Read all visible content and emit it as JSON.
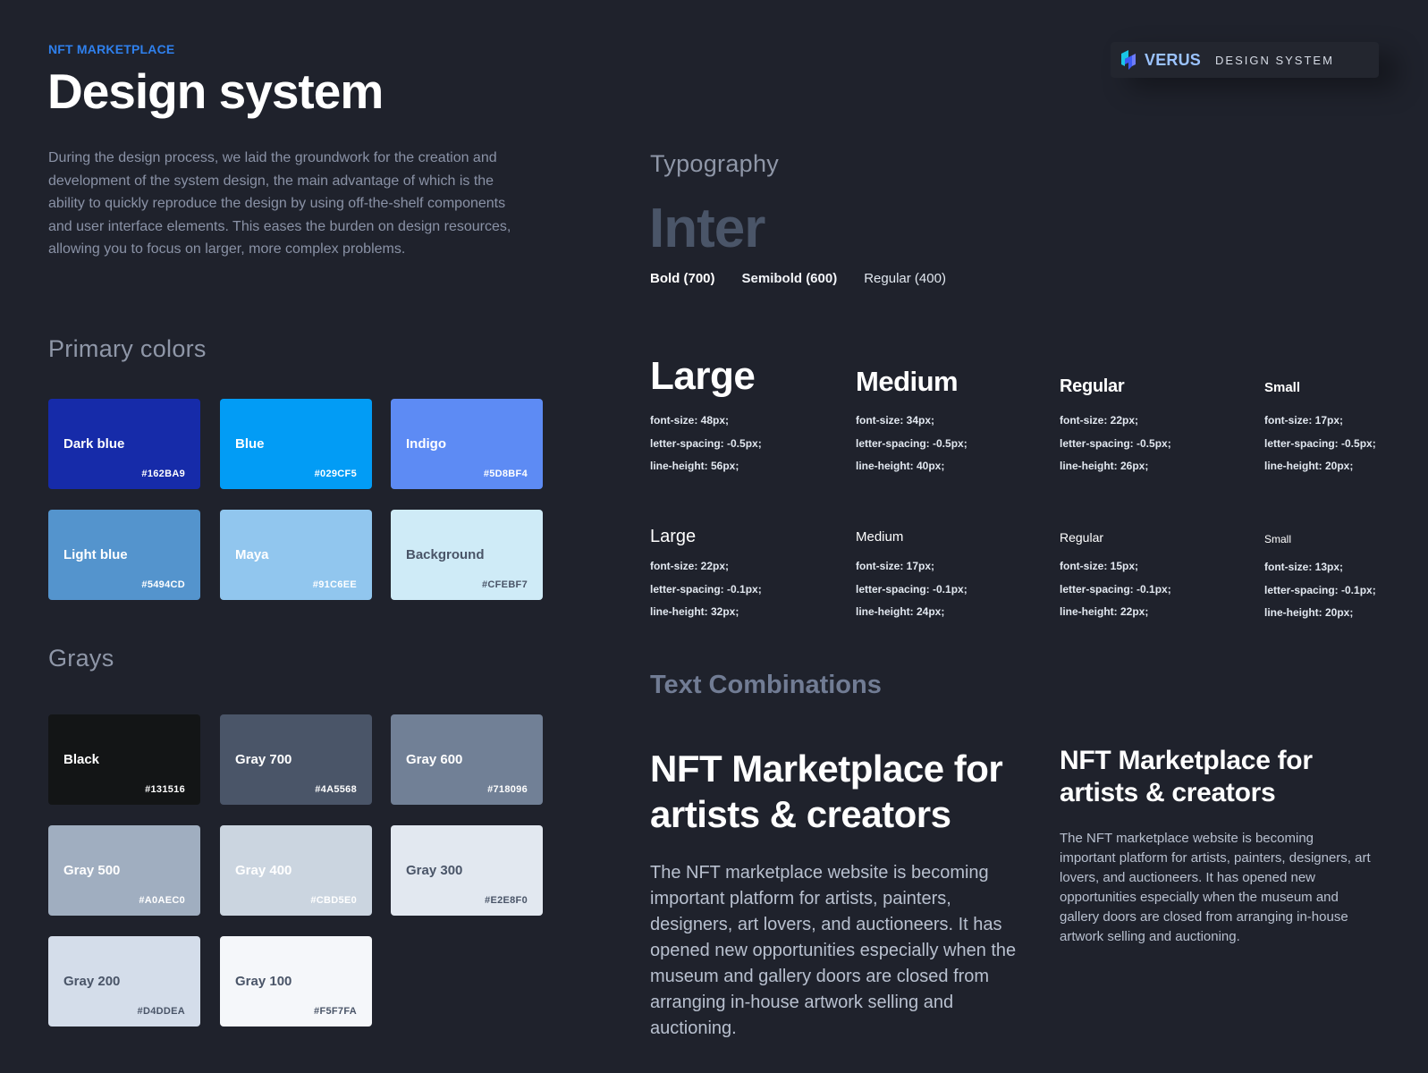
{
  "header": {
    "eyebrow": "NFT MARKETPLACE",
    "title": "Design system",
    "intro": "During the design process, we laid the groundwork for the creation and development of the system design, the main advantage of which is the ability to quickly reproduce the design by using off-the-shelf components and user interface elements. This eases the burden on design resources, allowing you to focus on larger, more complex problems."
  },
  "brand": {
    "icon": "verus-logo-icon",
    "name": "VERUS",
    "subtitle": "DESIGN SYSTEM"
  },
  "primary": {
    "heading": "Primary colors",
    "swatches": [
      {
        "name": "Dark blue",
        "hex": "#162BA9",
        "color": "#162BA9",
        "text": "#ffffff"
      },
      {
        "name": "Blue",
        "hex": "#029CF5",
        "color": "#029CF5",
        "text": "#ffffff"
      },
      {
        "name": "Indigo",
        "hex": "#5D8BF4",
        "color": "#5D8BF4",
        "text": "#ffffff"
      },
      {
        "name": "Light blue",
        "hex": "#5494CD",
        "color": "#5494CD",
        "text": "#ffffff"
      },
      {
        "name": "Maya",
        "hex": "#91C6EE",
        "color": "#91C6EE",
        "text": "#ffffff"
      },
      {
        "name": "Background",
        "hex": "#CFEBF7",
        "color": "#CFEBF7",
        "text": "#4a5568"
      }
    ]
  },
  "grays": {
    "heading": "Grays",
    "swatches": [
      {
        "name": "Black",
        "hex": "#131516",
        "color": "#131516",
        "text": "#ffffff"
      },
      {
        "name": "Gray 700",
        "hex": "#4A5568",
        "color": "#4A5568",
        "text": "#ffffff"
      },
      {
        "name": "Gray 600",
        "hex": "#718096",
        "color": "#718096",
        "text": "#ffffff"
      },
      {
        "name": "Gray 500",
        "hex": "#A0AEC0",
        "color": "#A0AEC0",
        "text": "#ffffff"
      },
      {
        "name": "Gray 400",
        "hex": "#CBD5E0",
        "color": "#CBD5E0",
        "text": "#ffffff"
      },
      {
        "name": "Gray 300",
        "hex": "#E2E8F0",
        "color": "#E2E8F0",
        "text": "#4a5568"
      },
      {
        "name": "Gray 200",
        "hex": "#D4DDEA",
        "color": "#D4DDEA",
        "text": "#4a5568"
      },
      {
        "name": "Gray 100",
        "hex": "#F5F7FA",
        "color": "#F5F7FA",
        "text": "#4a5568"
      }
    ]
  },
  "typography": {
    "heading": "Typography",
    "font": "Inter",
    "weights": [
      "Bold (700)",
      "Semibold (600)",
      "Regular (400)"
    ],
    "headings": [
      {
        "label": "Large",
        "size": "font-size: 48px;",
        "spacing": "letter-spacing: -0.5px;",
        "line": "line-height: 56px;"
      },
      {
        "label": "Medium",
        "size": "font-size: 34px;",
        "spacing": "letter-spacing: -0.5px;",
        "line": "line-height: 40px;"
      },
      {
        "label": "Regular",
        "size": "font-size: 22px;",
        "spacing": "letter-spacing: -0.5px;",
        "line": "line-height: 26px;"
      },
      {
        "label": "Small",
        "size": "font-size: 17px;",
        "spacing": "letter-spacing: -0.5px;",
        "line": "line-height: 20px;"
      }
    ],
    "body": [
      {
        "label": "Large",
        "size": "font-size: 22px;",
        "spacing": "letter-spacing: -0.1px;",
        "line": "line-height: 32px;"
      },
      {
        "label": "Medium",
        "size": "font-size: 17px;",
        "spacing": "letter-spacing: -0.1px;",
        "line": "line-height: 24px;"
      },
      {
        "label": "Regular",
        "size": "font-size: 15px;",
        "spacing": "letter-spacing: -0.1px;",
        "line": "line-height: 22px;"
      },
      {
        "label": "Small",
        "size": "font-size: 13px;",
        "spacing": "letter-spacing: -0.1px;",
        "line": "line-height: 20px;"
      }
    ]
  },
  "combinations": {
    "heading": "Text Combinations",
    "large": {
      "title": "NFT Marketplace for artists & creators",
      "body": "The NFT marketplace website is becoming important platform for artists, painters, designers, art lovers, and auctioneers. It has opened new opportunities especially when the museum and gallery doors are closed from arranging in-house artwork selling and auctioning."
    },
    "small": {
      "title": "NFT Marketplace for artists & creators",
      "body": "The NFT marketplace website is becoming important platform for artists, painters, designers, art lovers, and auctioneers. It has opened new opportunities especially when the museum and gallery doors are closed from arranging in-house artwork selling and auctioning."
    }
  }
}
